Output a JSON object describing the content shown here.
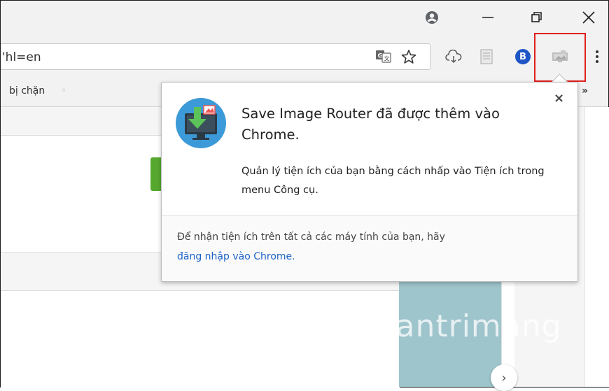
{
  "omnibox": {
    "url_fragment": "'hl=en"
  },
  "bookmarks": {
    "item1": "bị chặn",
    "overflow": "»"
  },
  "profile_badge": "B",
  "popup": {
    "title": "Save Image Router đã được thêm vào Chrome.",
    "description": "Quản lý tiện ích của bạn bằng cách nhấp vào Tiện ích trong menu Công cụ.",
    "footer_text": "Để nhận tiện ích trên tất cả các máy tính của bạn, hãy",
    "footer_link": "đăng nhập vào Chrome.",
    "close": "×"
  },
  "page": {
    "next_arrow": "›"
  },
  "watermark": "Quantrimang",
  "colors": {
    "highlight": "#e0201f",
    "link": "#1a63c7",
    "teal_panel": "#9ec4cc",
    "green_button": "#57a82f",
    "profile_badge": "#1f56c6"
  },
  "icons": [
    "account-icon",
    "minimize-icon",
    "restore-icon",
    "close-icon",
    "translate-icon",
    "star-icon",
    "cloud-download-icon",
    "reader-icon",
    "profile-badge-icon",
    "save-image-router-icon",
    "chrome-menu-icon"
  ]
}
